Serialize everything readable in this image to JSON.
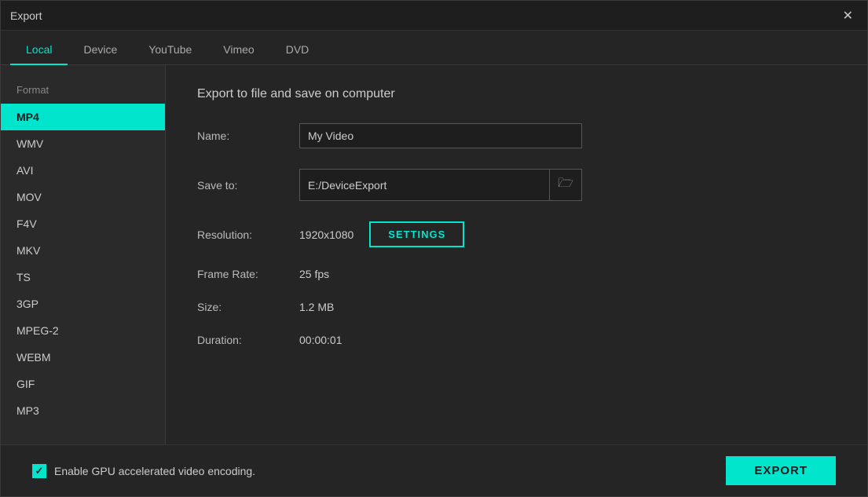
{
  "window": {
    "title": "Export"
  },
  "tabs": [
    {
      "id": "local",
      "label": "Local",
      "active": true
    },
    {
      "id": "device",
      "label": "Device",
      "active": false
    },
    {
      "id": "youtube",
      "label": "YouTube",
      "active": false
    },
    {
      "id": "vimeo",
      "label": "Vimeo",
      "active": false
    },
    {
      "id": "dvd",
      "label": "DVD",
      "active": false
    }
  ],
  "sidebar": {
    "format_label": "Format",
    "items": [
      {
        "id": "mp4",
        "label": "MP4",
        "active": true
      },
      {
        "id": "wmv",
        "label": "WMV",
        "active": false
      },
      {
        "id": "avi",
        "label": "AVI",
        "active": false
      },
      {
        "id": "mov",
        "label": "MOV",
        "active": false
      },
      {
        "id": "f4v",
        "label": "F4V",
        "active": false
      },
      {
        "id": "mkv",
        "label": "MKV",
        "active": false
      },
      {
        "id": "ts",
        "label": "TS",
        "active": false
      },
      {
        "id": "3gp",
        "label": "3GP",
        "active": false
      },
      {
        "id": "mpeg2",
        "label": "MPEG-2",
        "active": false
      },
      {
        "id": "webm",
        "label": "WEBM",
        "active": false
      },
      {
        "id": "gif",
        "label": "GIF",
        "active": false
      },
      {
        "id": "mp3",
        "label": "MP3",
        "active": false
      }
    ]
  },
  "main": {
    "panel_title": "Export to file and save on computer",
    "name_label": "Name:",
    "name_value": "My Video",
    "save_to_label": "Save to:",
    "save_to_value": "E:/DeviceExport",
    "resolution_label": "Resolution:",
    "resolution_value": "1920x1080",
    "settings_btn_label": "SETTINGS",
    "frame_rate_label": "Frame Rate:",
    "frame_rate_value": "25 fps",
    "size_label": "Size:",
    "size_value": "1.2 MB",
    "duration_label": "Duration:",
    "duration_value": "00:00:01"
  },
  "bottom": {
    "checkbox_label": "Enable GPU accelerated video encoding.",
    "export_btn_label": "EXPORT"
  },
  "icons": {
    "close": "✕",
    "folder": "🗀"
  }
}
